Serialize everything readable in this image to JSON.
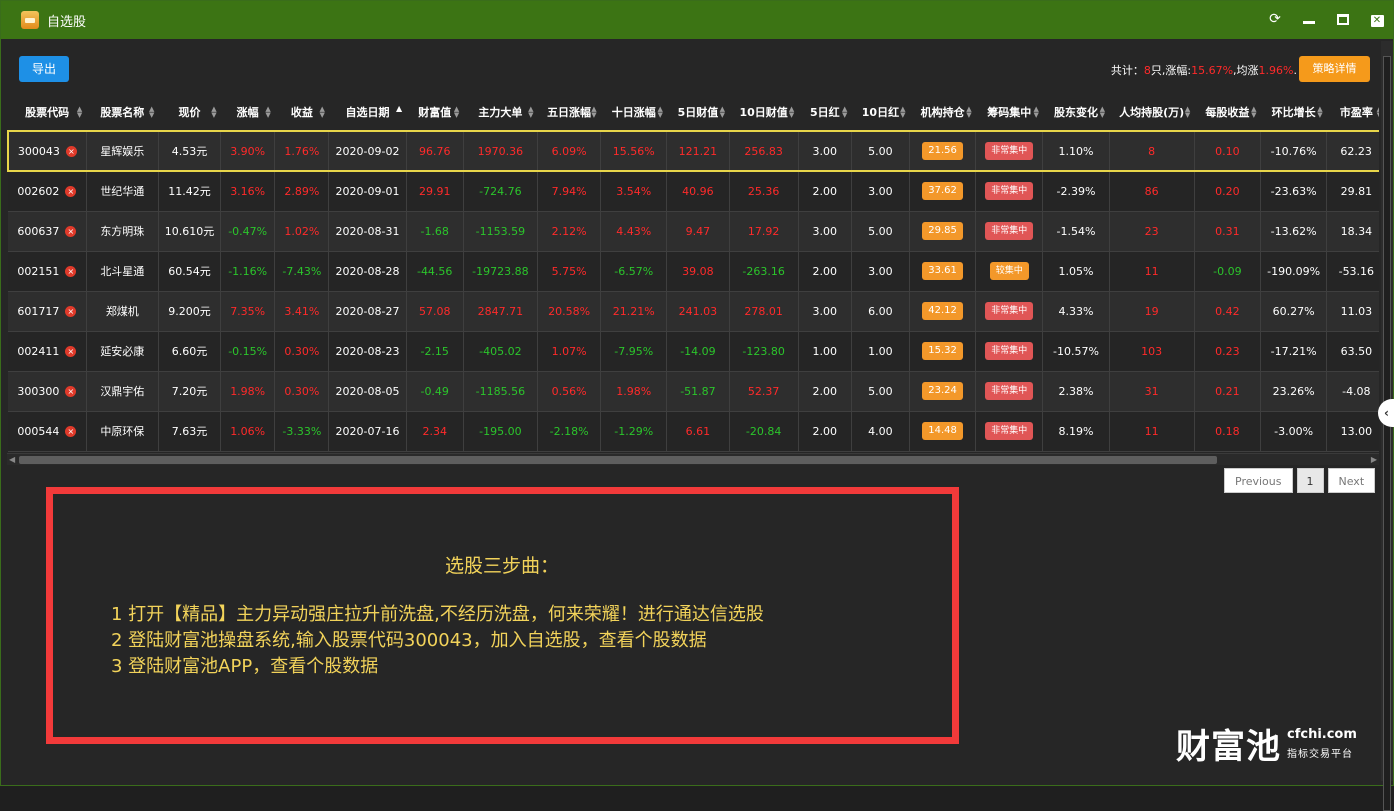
{
  "window": {
    "title": "自选股"
  },
  "toolbar": {
    "export_label": "导出",
    "strategy_label": "策略详情",
    "summary_prefix": "共计：",
    "summary_count": "8",
    "summary_mid": "只,涨幅:",
    "summary_gain": "15.67%",
    "summary_mid2": ",均涨",
    "summary_avg": "1.96%",
    "summary_suffix": "."
  },
  "table": {
    "columns": [
      "股票代码",
      "股票名称",
      "现价",
      "涨幅",
      "收益",
      "自选日期",
      "财富值",
      "主力大单",
      "五日涨幅",
      "十日涨幅",
      "5日财值",
      "10日财值",
      "5日红",
      "10日红",
      "机构持仓",
      "筹码集中",
      "股东变化",
      "人均持股(万)",
      "每股收益",
      "环比增长",
      "市盈率"
    ],
    "rows": [
      {
        "code": "300043",
        "name": "星辉娱乐",
        "price": "4.53元",
        "change": "3.90%",
        "profit": "1.76%",
        "date": "2020-09-02",
        "wealth": "96.76",
        "main": "1970.36",
        "d5": "6.09%",
        "d10": "15.56%",
        "w5": "121.21",
        "w10": "256.83",
        "r5": "3.00",
        "r10": "5.00",
        "inst": "21.56",
        "chip": "非常集中",
        "holder": "1.10%",
        "per": "8",
        "eps": "0.10",
        "qoq": "-10.76%",
        "pe": "62.23"
      },
      {
        "code": "002602",
        "name": "世纪华通",
        "price": "11.42元",
        "change": "3.16%",
        "profit": "2.89%",
        "date": "2020-09-01",
        "wealth": "29.91",
        "main": "-724.76",
        "d5": "7.94%",
        "d10": "3.54%",
        "w5": "40.96",
        "w10": "25.36",
        "r5": "2.00",
        "r10": "3.00",
        "inst": "37.62",
        "chip": "非常集中",
        "holder": "-2.39%",
        "per": "86",
        "eps": "0.20",
        "qoq": "-23.63%",
        "pe": "29.81"
      },
      {
        "code": "600637",
        "name": "东方明珠",
        "price": "10.610元",
        "change": "-0.47%",
        "profit": "1.02%",
        "date": "2020-08-31",
        "wealth": "-1.68",
        "main": "-1153.59",
        "d5": "2.12%",
        "d10": "4.43%",
        "w5": "9.47",
        "w10": "17.92",
        "r5": "3.00",
        "r10": "5.00",
        "inst": "29.85",
        "chip": "非常集中",
        "holder": "-1.54%",
        "per": "23",
        "eps": "0.31",
        "qoq": "-13.62%",
        "pe": "18.34"
      },
      {
        "code": "002151",
        "name": "北斗星通",
        "price": "60.54元",
        "change": "-1.16%",
        "profit": "-7.43%",
        "date": "2020-08-28",
        "wealth": "-44.56",
        "main": "-19723.88",
        "d5": "5.75%",
        "d10": "-6.57%",
        "w5": "39.08",
        "w10": "-263.16",
        "r5": "2.00",
        "r10": "3.00",
        "inst": "33.61",
        "chip": "较集中",
        "holder": "1.05%",
        "per": "11",
        "eps": "-0.09",
        "qoq": "-190.09%",
        "pe": "-53.16"
      },
      {
        "code": "601717",
        "name": "郑煤机",
        "price": "9.200元",
        "change": "7.35%",
        "profit": "3.41%",
        "date": "2020-08-27",
        "wealth": "57.08",
        "main": "2847.71",
        "d5": "20.58%",
        "d10": "21.21%",
        "w5": "241.03",
        "w10": "278.01",
        "r5": "3.00",
        "r10": "6.00",
        "inst": "42.12",
        "chip": "非常集中",
        "holder": "4.33%",
        "per": "19",
        "eps": "0.42",
        "qoq": "60.27%",
        "pe": "11.03"
      },
      {
        "code": "002411",
        "name": "延安必康",
        "price": "6.60元",
        "change": "-0.15%",
        "profit": "0.30%",
        "date": "2020-08-23",
        "wealth": "-2.15",
        "main": "-405.02",
        "d5": "1.07%",
        "d10": "-7.95%",
        "w5": "-14.09",
        "w10": "-123.80",
        "r5": "1.00",
        "r10": "1.00",
        "inst": "15.32",
        "chip": "非常集中",
        "holder": "-10.57%",
        "per": "103",
        "eps": "0.23",
        "qoq": "-17.21%",
        "pe": "63.50"
      },
      {
        "code": "300300",
        "name": "汉鼎宇佑",
        "price": "7.20元",
        "change": "1.98%",
        "profit": "0.30%",
        "date": "2020-08-05",
        "wealth": "-0.49",
        "main": "-1185.56",
        "d5": "0.56%",
        "d10": "1.98%",
        "w5": "-51.87",
        "w10": "52.37",
        "r5": "2.00",
        "r10": "5.00",
        "inst": "23.24",
        "chip": "非常集中",
        "holder": "2.38%",
        "per": "31",
        "eps": "0.21",
        "qoq": "23.26%",
        "pe": "-4.08"
      },
      {
        "code": "000544",
        "name": "中原环保",
        "price": "7.63元",
        "change": "1.06%",
        "profit": "-3.33%",
        "date": "2020-07-16",
        "wealth": "2.34",
        "main": "-195.00",
        "d5": "-2.18%",
        "d10": "-1.29%",
        "w5": "6.61",
        "w10": "-20.84",
        "r5": "2.00",
        "r10": "4.00",
        "inst": "14.48",
        "chip": "非常集中",
        "holder": "8.19%",
        "per": "11",
        "eps": "0.18",
        "qoq": "-3.00%",
        "pe": "13.00"
      }
    ]
  },
  "pagination": {
    "previous": "Previous",
    "page": "1",
    "next": "Next"
  },
  "promo": {
    "title": "选股三步曲：",
    "lines": [
      "1 打开【精品】主力异动强庄拉升前洗盘,不经历洗盘，何来荣耀！进行通达信选股",
      "2 登陆财富池操盘系统,输入股票代码300043，加入自选股，查看个股数据",
      "3 登陆财富池APP，查看个股数据"
    ]
  },
  "logo": {
    "name": "财富池",
    "domain": "cfchi.com",
    "tagline": "指标交易平台"
  },
  "colors": {
    "titlebar": "#3c7414",
    "up": "#ff2a2a",
    "down": "#2bc52b",
    "accent": "#1e90e6",
    "orange": "#f59a1b"
  }
}
